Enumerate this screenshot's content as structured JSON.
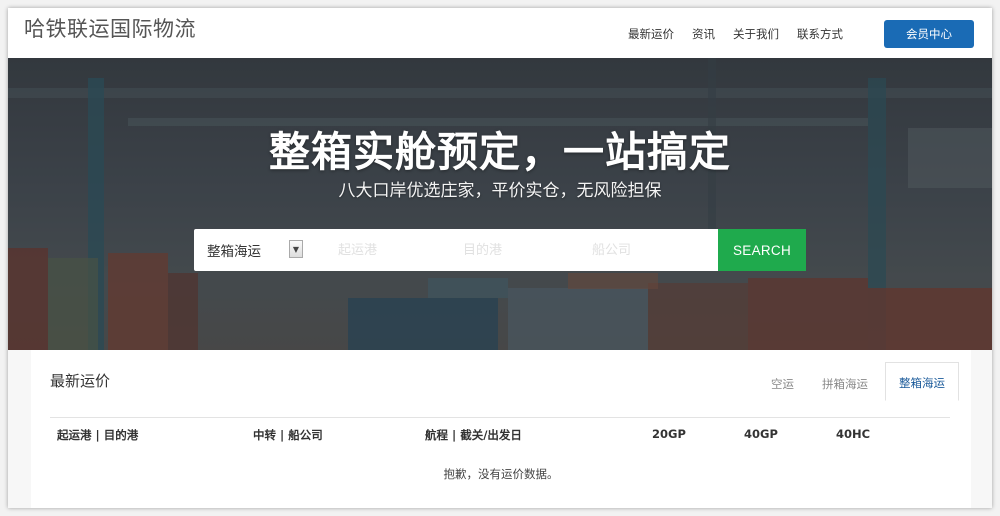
{
  "header": {
    "logo": "哈铁联运国际物流",
    "nav": [
      "最新运价",
      "资讯",
      "关于我们",
      "联系方式"
    ],
    "member_button": "会员中心"
  },
  "hero": {
    "title": "整箱实舱预定，一站搞定",
    "subtitle": "八大口岸优选庄家，平价实仓，无风险担保"
  },
  "search": {
    "mode_selected": "整箱海运",
    "origin_placeholder": "起运港",
    "destination_placeholder": "目的港",
    "carrier_placeholder": "船公司",
    "button": "SEARCH"
  },
  "rates": {
    "title": "最新运价",
    "tabs": [
      "空运",
      "拼箱海运",
      "整箱海运"
    ],
    "active_tab": "整箱海运",
    "columns": [
      "起运港 | 目的港",
      "中转 | 船公司",
      "航程 | 截关/出发日",
      "20GP",
      "40GP",
      "40HC"
    ],
    "empty_message": "抱歉，没有运价数据。"
  },
  "colors": {
    "primary": "#1a6bb5",
    "search_button": "#1faa4d",
    "active_tab_text": "#1a5a9a"
  }
}
